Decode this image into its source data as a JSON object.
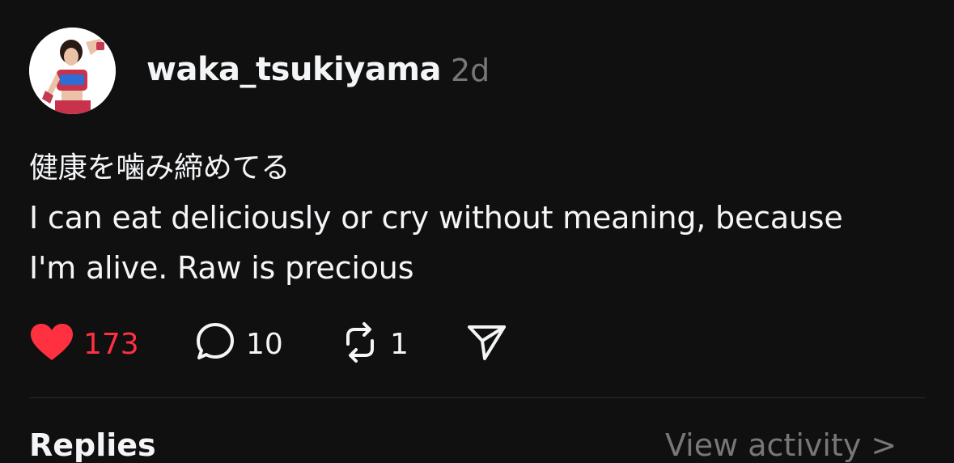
{
  "post": {
    "username": "waka_tsukiyama",
    "timestamp": "2d",
    "text_jp": "健康を噛み締めてる",
    "text_en_line1": "I can eat deliciously or cry without meaning, because",
    "text_en_line2": "I'm alive. Raw is precious",
    "likes": "173",
    "replies": "10",
    "reposts": "1",
    "liked": true
  },
  "footer": {
    "replies_label": "Replies",
    "view_activity": "View activity >"
  },
  "colors": {
    "background": "#101010",
    "text": "#f3f5f7",
    "muted": "#777777",
    "like": "#ff3040",
    "divider": "#2d2d2d"
  },
  "icons": {
    "like": "heart-icon",
    "reply": "comment-icon",
    "repost": "repost-icon",
    "share": "send-icon"
  }
}
